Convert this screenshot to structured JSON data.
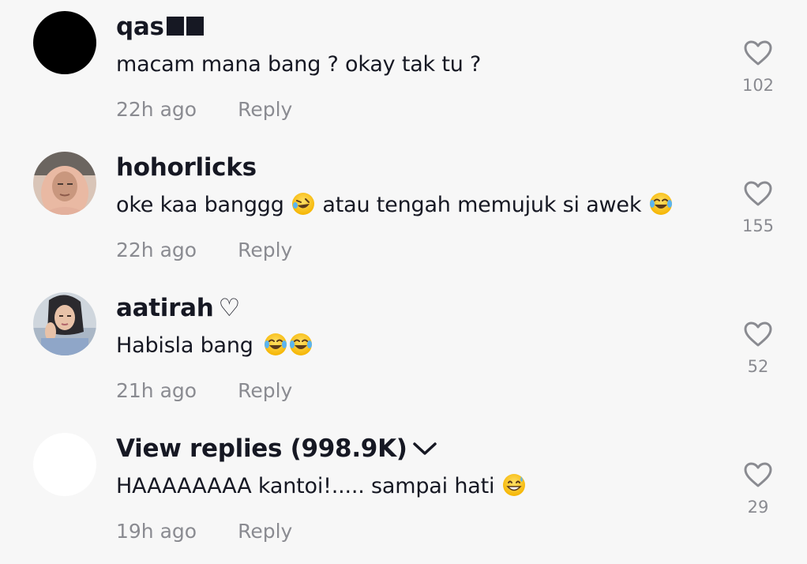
{
  "comments": [
    {
      "username": "qas",
      "username_suffix": "❓❓",
      "text": "macam mana bang ? okay tak tu ?",
      "time": "22h ago",
      "reply_label": "Reply",
      "likes": "102",
      "avatar": "dark-avatar"
    },
    {
      "username": "hohorlicks",
      "text_before": "oke kaa banggg",
      "text_after": "atau tengah memujuk si awek",
      "emoji_1": "rolling-on-floor-laughing",
      "emoji_2": "tears-of-joy",
      "time": "22h ago",
      "reply_label": "Reply",
      "likes": "155",
      "avatar": "hijab-woman-photo"
    },
    {
      "username": "aatirah",
      "username_suffix": "♡",
      "text": "Habisla bang",
      "emojis": [
        "tears-of-joy",
        "tears-of-joy"
      ],
      "time": "21h ago",
      "reply_label": "Reply",
      "likes": "52",
      "avatar": "woman-dark-hijab-photo"
    },
    {
      "username": "View replies (998.9K)",
      "text": "HAAAAAAAA kantoi!..... sampai hati",
      "emoji": "grinning-sweat",
      "time": "19h ago",
      "reply_label": "Reply",
      "likes": "29",
      "avatar": "blank-white-avatar"
    }
  ],
  "colors": {
    "background": "#f7f7f7",
    "primary_text": "#161823",
    "secondary_text": "#8a8b91",
    "heart_outline": "#8a8b91"
  }
}
